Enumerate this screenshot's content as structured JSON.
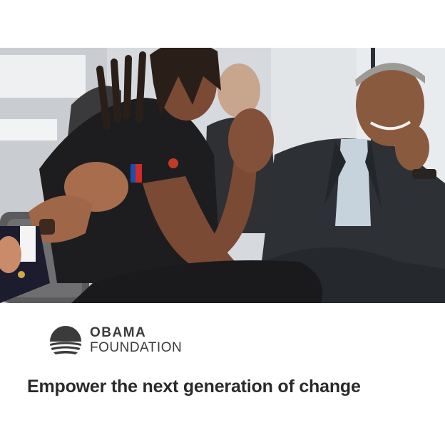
{
  "ad": {
    "brand_line1": "OBAMA",
    "brand_line2": "FOUNDATION",
    "logo_icon": "obama-foundation-sunrise-logo",
    "headline": "Empower the next generation of change"
  },
  "photo": {
    "icon": "event-photo"
  },
  "colors": {
    "text": "#2a2a2a",
    "logo": "#3b3b3b",
    "background": "#ffffff"
  }
}
